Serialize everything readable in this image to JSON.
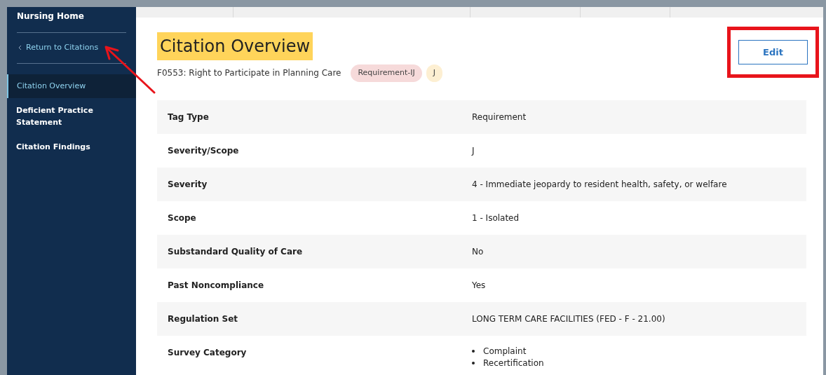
{
  "sidebar": {
    "title": "Nursing Home",
    "back_link": "Return to Citations",
    "items": [
      {
        "label": "Citation Overview",
        "selected": true
      },
      {
        "label": "Deficient Practice Statement",
        "selected": false
      },
      {
        "label": "Citation Findings",
        "selected": false
      }
    ]
  },
  "header": {
    "title": "Citation Overview",
    "subtitle": "F0553: Right to Participate in Planning Care",
    "badges": [
      {
        "label": "Requirement-IJ",
        "color": "#f6dada"
      },
      {
        "label": "J",
        "color": "#fdefd2"
      }
    ],
    "edit_button": "Edit"
  },
  "details": [
    {
      "label": "Tag Type",
      "value": "Requirement"
    },
    {
      "label": "Severity/Scope",
      "value": "J"
    },
    {
      "label": "Severity",
      "value": "4 - Immediate jeopardy to resident health, safety, or welfare"
    },
    {
      "label": "Scope",
      "value": "1 - Isolated"
    },
    {
      "label": "Substandard Quality of Care",
      "value": "No"
    },
    {
      "label": "Past Noncompliance",
      "value": "Yes"
    },
    {
      "label": "Regulation Set",
      "value": "LONG TERM CARE FACILITIES (FED - F - 21.00)"
    },
    {
      "label": "Survey Category",
      "list": [
        "Complaint",
        "Recertification"
      ]
    }
  ]
}
